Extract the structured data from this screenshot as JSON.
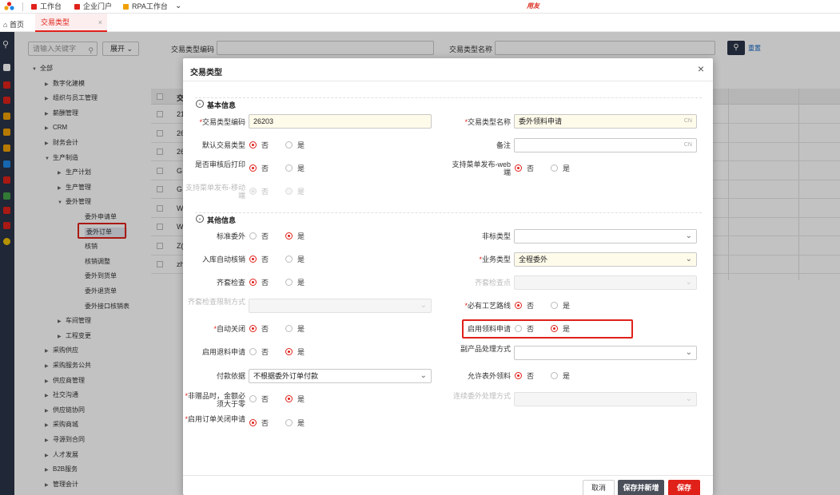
{
  "topbar": {
    "tabs": [
      {
        "label": "工作台",
        "color": "#e0211a"
      },
      {
        "label": "企业门户",
        "color": "#e0211a"
      },
      {
        "label": "RPA工作台",
        "color": "#f0a000"
      }
    ],
    "brand": "用友"
  },
  "tabbar": {
    "home": "首页",
    "active_tab": "交易类型"
  },
  "tree": {
    "search_placeholder": "请输入关键字",
    "expand_label": "展开",
    "nodes": [
      {
        "label": "全部",
        "level": 0,
        "arrow": "▼"
      },
      {
        "label": "数字化建模",
        "level": 1,
        "arrow": "▶"
      },
      {
        "label": "组织与员工管理",
        "level": 1,
        "arrow": "▶"
      },
      {
        "label": "薪酬管理",
        "level": 1,
        "arrow": "▶"
      },
      {
        "label": "CRM",
        "level": 1,
        "arrow": "▶"
      },
      {
        "label": "财务会计",
        "level": 1,
        "arrow": "▶"
      },
      {
        "label": "生产制造",
        "level": 1,
        "arrow": "▼"
      },
      {
        "label": "生产计划",
        "level": 2,
        "arrow": "▶"
      },
      {
        "label": "生产管理",
        "level": 2,
        "arrow": "▶"
      },
      {
        "label": "委外管理",
        "level": 2,
        "arrow": "▼"
      },
      {
        "label": "委外申请单",
        "level": 3,
        "arrow": ""
      },
      {
        "label": "委外订单",
        "level": 3,
        "arrow": "",
        "selected": true
      },
      {
        "label": "核销",
        "level": 3,
        "arrow": ""
      },
      {
        "label": "核销调整",
        "level": 3,
        "arrow": ""
      },
      {
        "label": "委外到货单",
        "level": 3,
        "arrow": ""
      },
      {
        "label": "委外退货单",
        "level": 3,
        "arrow": ""
      },
      {
        "label": "委外接口核销表",
        "level": 3,
        "arrow": ""
      },
      {
        "label": "车间管理",
        "level": 2,
        "arrow": "▶"
      },
      {
        "label": "工程变更",
        "level": 2,
        "arrow": "▶"
      },
      {
        "label": "采购供应",
        "level": 1,
        "arrow": "▶"
      },
      {
        "label": "采购服务公共",
        "level": 1,
        "arrow": "▶"
      },
      {
        "label": "供应商管理",
        "level": 1,
        "arrow": "▶"
      },
      {
        "label": "社交沟通",
        "level": 1,
        "arrow": "▶"
      },
      {
        "label": "供应链协同",
        "level": 1,
        "arrow": "▶"
      },
      {
        "label": "采购商城",
        "level": 1,
        "arrow": "▶"
      },
      {
        "label": "寻源到合同",
        "level": 1,
        "arrow": "▶"
      },
      {
        "label": "人才发展",
        "level": 1,
        "arrow": "▶"
      },
      {
        "label": "B2B服务",
        "level": 1,
        "arrow": "▶"
      },
      {
        "label": "管理会计",
        "level": 1,
        "arrow": "▶"
      }
    ]
  },
  "filter": {
    "code_label": "交易类型编码",
    "name_label": "交易类型名称",
    "reset_label": "重置"
  },
  "grid": {
    "header_first": "交",
    "rows": [
      "21",
      "26",
      "26",
      "G",
      "G",
      "W",
      "W",
      "Z(",
      "zh"
    ]
  },
  "modal": {
    "title": "交易类型",
    "section_basic": "基本信息",
    "section_other": "其他信息",
    "yes": "是",
    "no": "否",
    "cn": "CN",
    "fields": {
      "code_label": "交易类型编码",
      "code_value": "26203",
      "name_label": "交易类型名称",
      "name_value": "委外领料申请",
      "default_label": "默认交易类型",
      "remark_label": "备注",
      "print_label": "是否审核后打印",
      "menu_web_label": "支持菜单发布-web端",
      "menu_mobile_label": "支持菜单发布-移动端",
      "std_label": "标准委外",
      "nonstd_label": "非标类型",
      "auto_verify_label": "入库自动核销",
      "biz_label": "业务类型",
      "biz_value": "全程委外",
      "kit_check_label": "齐套检查",
      "kit_point_label": "齐套检查点",
      "kit_limit_label": "齐套检查限制方式",
      "route_label": "必有工艺路线",
      "auto_close_label": "自动关闭",
      "pick_req_label": "启用领料申请",
      "return_req_label": "启用退料申请",
      "byproduct_label": "副产品处理方式",
      "pay_label": "付款依据",
      "pay_value": "不根据委外订单付款",
      "allow_outside_label": "允许表外领料",
      "nongift_label": "非赠品时，金额必须大于零",
      "continuous_label": "连续委外处理方式",
      "close_req_label": "启用订单关闭申请"
    },
    "buttons": {
      "cancel": "取消",
      "save_add": "保存并新增",
      "save": "保存"
    }
  }
}
